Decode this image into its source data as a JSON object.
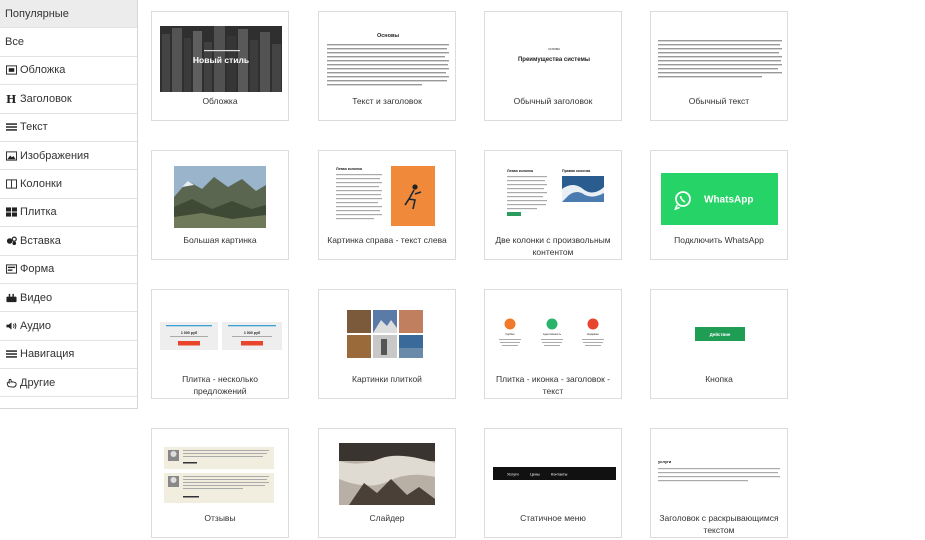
{
  "sidebar": {
    "items": [
      {
        "label": "Популярные",
        "icon": "none",
        "active": true
      },
      {
        "label": "Все",
        "icon": "none"
      },
      {
        "label": "Обложка",
        "icon": "cover-icon"
      },
      {
        "label": "Заголовок",
        "icon": "heading-icon"
      },
      {
        "label": "Текст",
        "icon": "text-lines-icon"
      },
      {
        "label": "Изображения",
        "icon": "image-icon"
      },
      {
        "label": "Колонки",
        "icon": "columns-icon"
      },
      {
        "label": "Плитка",
        "icon": "tiles-icon"
      },
      {
        "label": "Вставка",
        "icon": "embed-icon"
      },
      {
        "label": "Форма",
        "icon": "form-icon"
      },
      {
        "label": "Видео",
        "icon": "video-icon"
      },
      {
        "label": "Аудио",
        "icon": "audio-icon"
      },
      {
        "label": "Навигация",
        "icon": "nav-icon"
      },
      {
        "label": "Другие",
        "icon": "hand-icon"
      }
    ]
  },
  "blocks": [
    {
      "caption": "Обложка",
      "preview": {
        "title": "Новый стиль"
      }
    },
    {
      "caption": "Текст и заголовок",
      "preview": {
        "title": "Основы"
      }
    },
    {
      "caption": "Обычный заголовок",
      "preview": {
        "kicker": "основы",
        "title": "Преимущества системы"
      }
    },
    {
      "caption": "Обычный текст"
    },
    {
      "caption": "Большая картинка"
    },
    {
      "caption": "Картинка справа - текст слева",
      "preview": {
        "title": "Левая колонка"
      }
    },
    {
      "caption": "Две колонки с произвольным контентом",
      "preview": {
        "left": "Левая колонка",
        "right": "Правая колонка"
      }
    },
    {
      "caption": "Подключить WhatsApp",
      "preview": {
        "button": "WhatsApp"
      }
    },
    {
      "caption": "Плитка - несколько предложений",
      "preview": {
        "price": "1 000 руб"
      }
    },
    {
      "caption": "Картинки плиткой"
    },
    {
      "caption": "Плитка - иконка - заголовок - текст",
      "preview": {
        "labels": [
          "Удобно",
          "Адаптивность",
          "Надёжно"
        ]
      }
    },
    {
      "caption": "Кнопка",
      "preview": {
        "button": "Действие"
      }
    },
    {
      "caption": "Отзывы"
    },
    {
      "caption": "Слайдер"
    },
    {
      "caption": "Статичное меню",
      "preview": {
        "menu": [
          "Услуги",
          "Цены",
          "Контакты"
        ]
      }
    },
    {
      "caption": "Заголовок с раскрывающимся текстом",
      "preview": {
        "title": "услуги"
      }
    }
  ],
  "colors": {
    "whatsapp": "#25d366",
    "button_green": "#1f9d55",
    "accent_red": "#e8452c",
    "menu_bar": "#111111"
  }
}
